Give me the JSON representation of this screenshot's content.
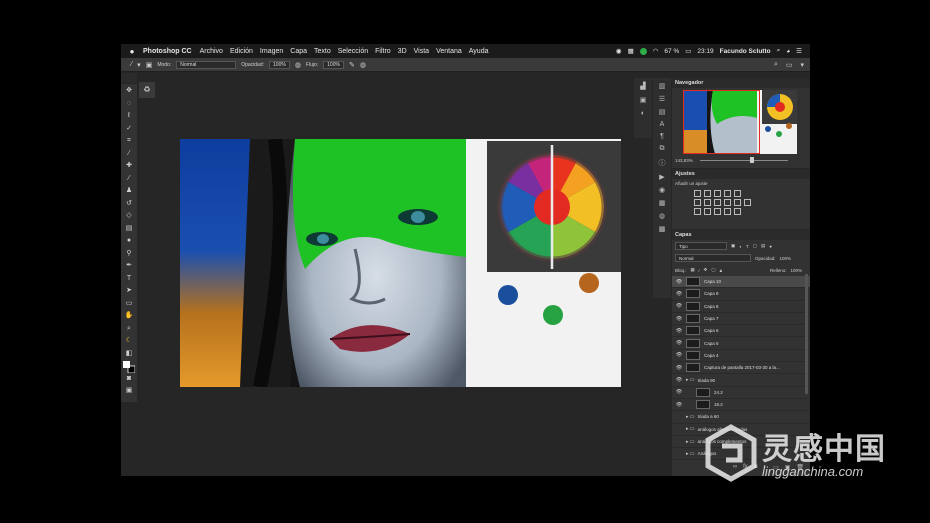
{
  "menubar": {
    "app_name": "Photoshop CC",
    "items": [
      "Archivo",
      "Edición",
      "Imagen",
      "Capa",
      "Texto",
      "Selección",
      "Filtro",
      "3D",
      "Vista",
      "Ventana",
      "Ayuda"
    ],
    "battery": "67 %",
    "time": "23:19",
    "user": "Facundo Sclutto"
  },
  "options": {
    "mode_label": "Modo:",
    "mode_value": "Normal",
    "opacity_label": "Opacidad:",
    "opacity_value": "100%",
    "flow_label": "Flujo:",
    "flow_value": "100%"
  },
  "navigator": {
    "title": "Navegador",
    "zoom": "143,93%"
  },
  "adjustments": {
    "title": "Ajustes",
    "subtitle": "Añadir un ajuste"
  },
  "layers": {
    "title": "Capas",
    "filter_value": "Tipo",
    "blend_value": "Normal",
    "opacity_label": "Opacidad:",
    "opacity_value": "100%",
    "lock_label": "Bloq.:",
    "fill_label": "Relleno:",
    "fill_value": "100%",
    "items": [
      {
        "name": "Capa 10",
        "active": true,
        "group": false
      },
      {
        "name": "Capa 9",
        "active": false,
        "group": false
      },
      {
        "name": "Capa 8",
        "active": false,
        "group": false
      },
      {
        "name": "Capa 7",
        "active": false,
        "group": false
      },
      {
        "name": "Capa 6",
        "active": false,
        "group": false
      },
      {
        "name": "Capa 5",
        "active": false,
        "group": false
      },
      {
        "name": "Capa 4",
        "active": false,
        "group": false
      },
      {
        "name": "Captura de pantalla 2017-03-30 a la...",
        "active": false,
        "group": false
      },
      {
        "name": "triada 90",
        "active": false,
        "group": true
      },
      {
        "name": "24.2",
        "active": false,
        "group": false
      },
      {
        "name": "18.2",
        "active": false,
        "group": false
      },
      {
        "name": "triada a 60",
        "active": false,
        "group": true
      },
      {
        "name": "análogos alternos ciadas",
        "active": false,
        "group": true
      },
      {
        "name": "análogos complementos",
        "active": false,
        "group": true
      },
      {
        "name": "Análogos",
        "active": false,
        "group": true
      }
    ]
  },
  "watermark": {
    "brand": "灵感中国",
    "site": "lingganchina.com"
  },
  "colors": {
    "orange_dot": "#b5651d",
    "blue_dot": "#1a4f9c",
    "green_dot": "#27a243",
    "face_paint": "#1fc224"
  }
}
